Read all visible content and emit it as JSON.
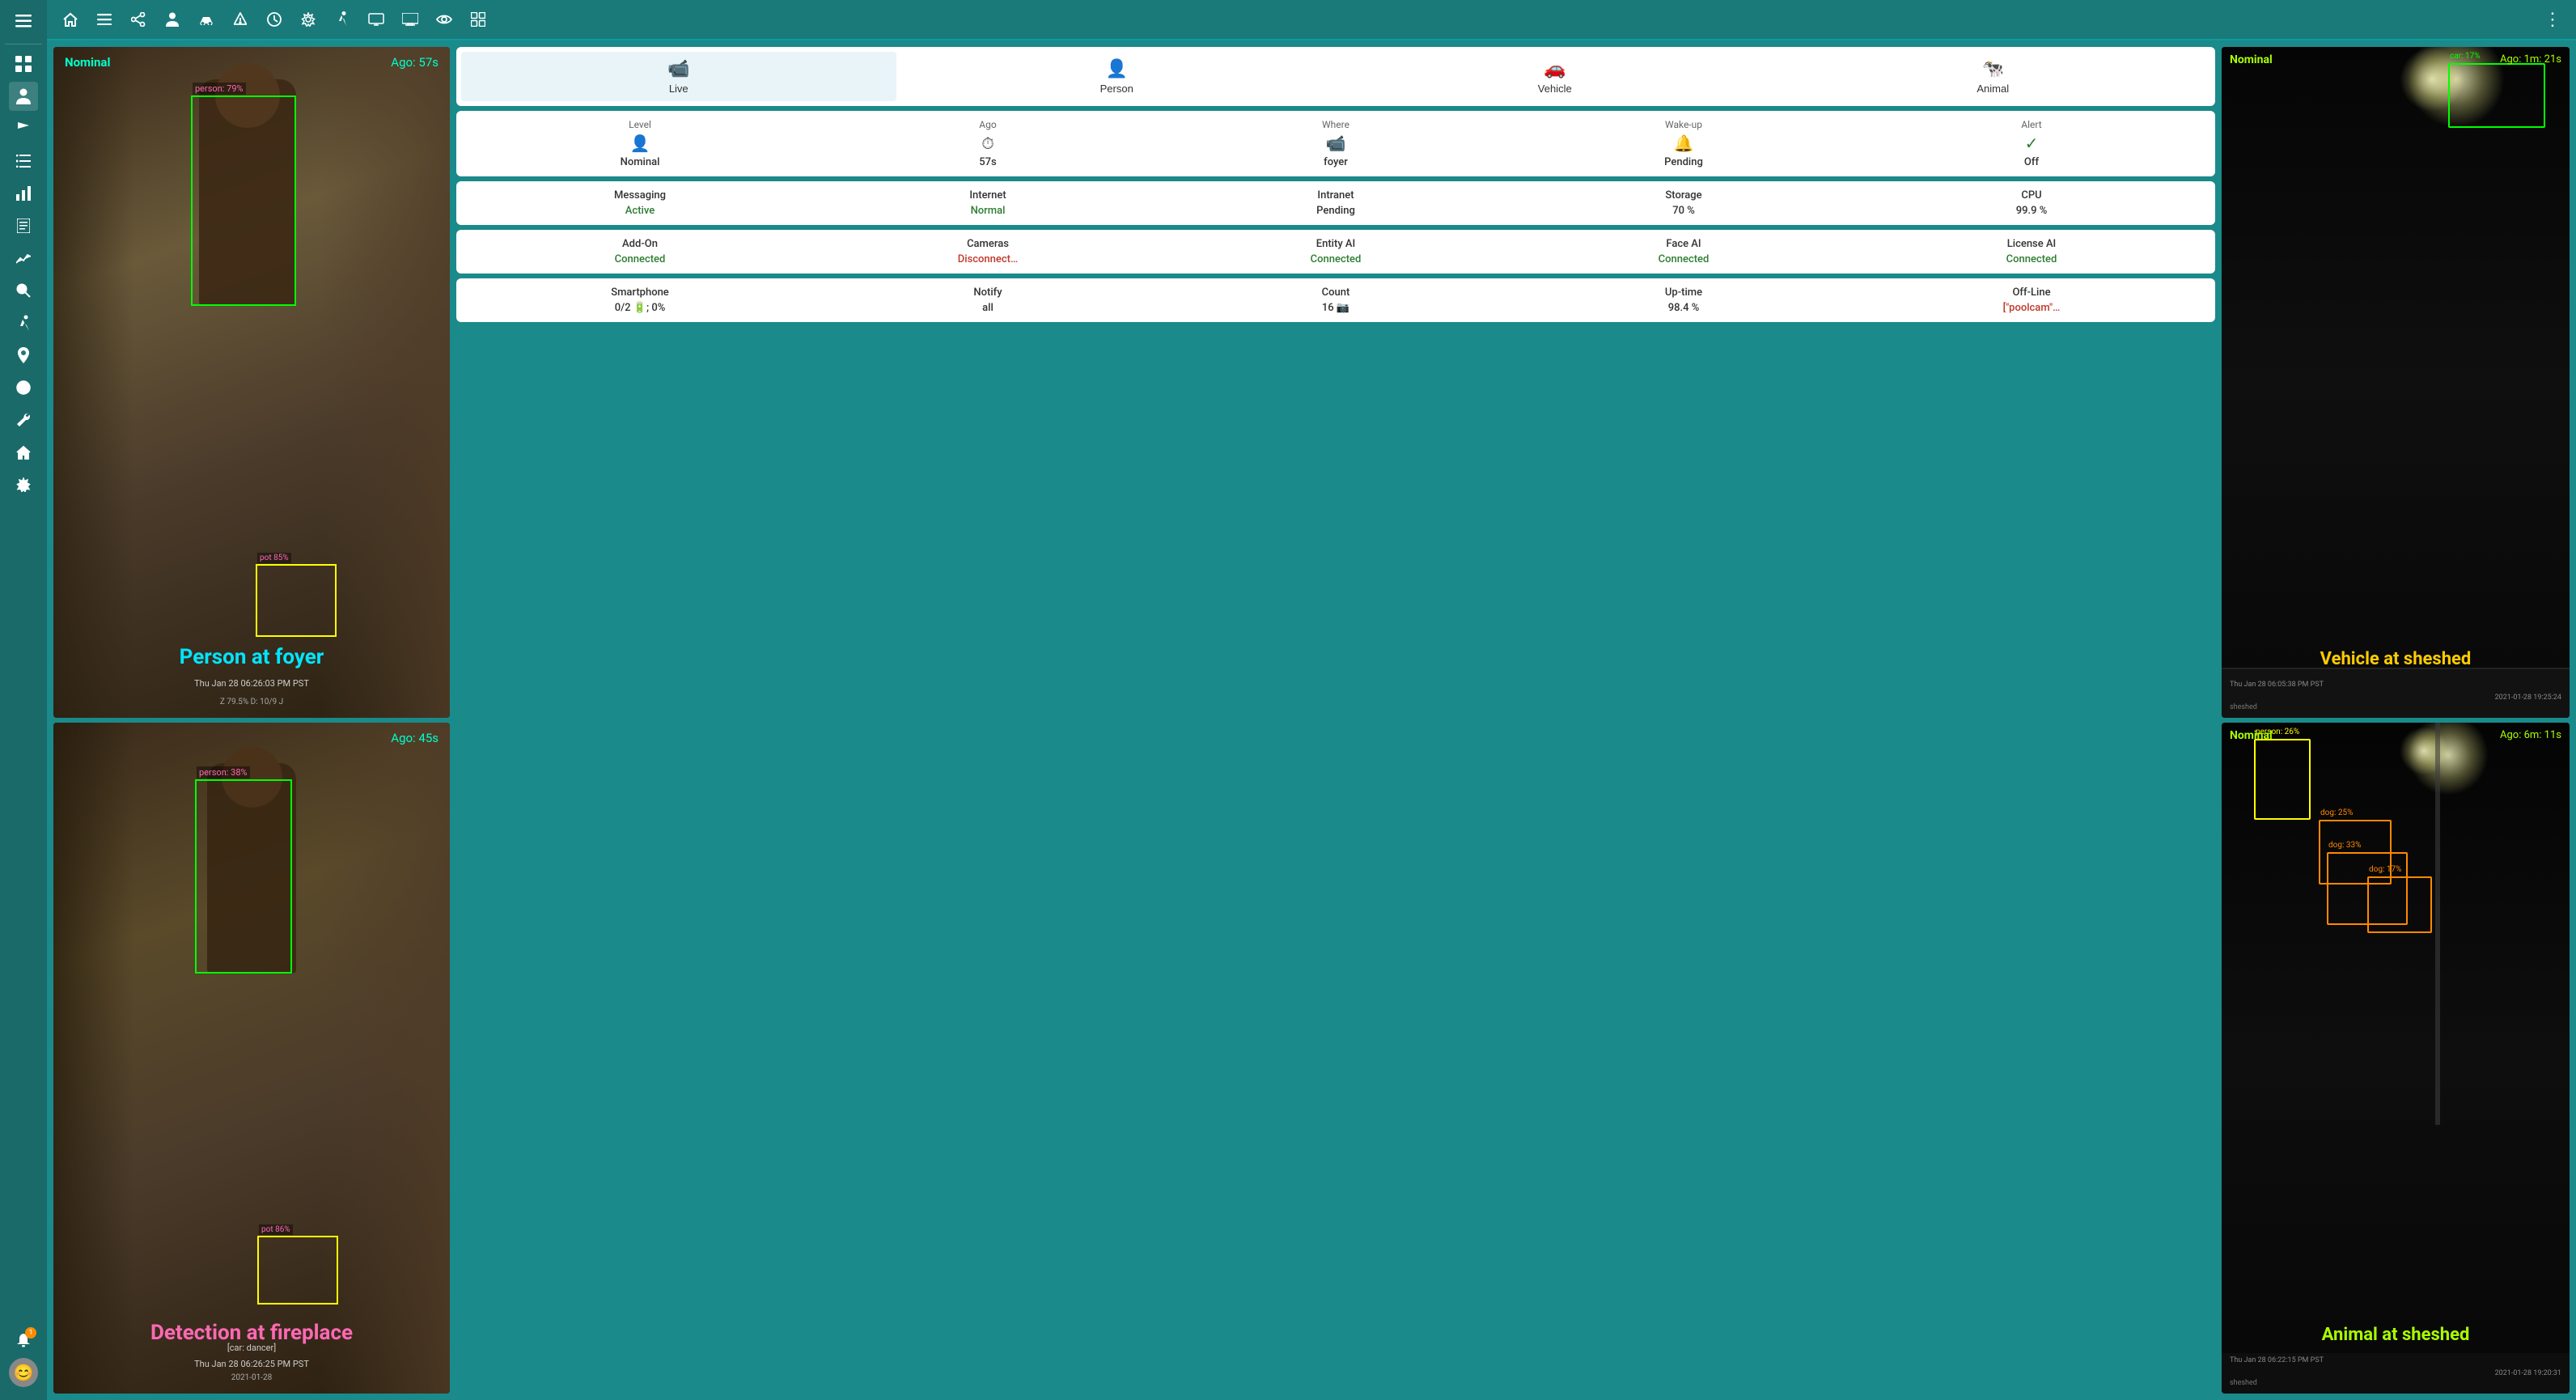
{
  "sidebar": {
    "items": [
      {
        "name": "menu",
        "icon": "☰"
      },
      {
        "name": "home",
        "icon": "⌂"
      },
      {
        "name": "collapse",
        "icon": "≡"
      },
      {
        "name": "share",
        "icon": "⎇"
      },
      {
        "name": "person",
        "icon": "👤"
      },
      {
        "name": "vehicle",
        "icon": "🚗"
      },
      {
        "name": "bug",
        "icon": "🐛"
      },
      {
        "name": "clock",
        "icon": "⏰"
      },
      {
        "name": "settings",
        "icon": "⚙"
      },
      {
        "name": "walk",
        "icon": "🚶"
      },
      {
        "name": "display",
        "icon": "📺"
      },
      {
        "name": "monitor",
        "icon": "🖥"
      },
      {
        "name": "eye",
        "icon": "👁"
      },
      {
        "name": "grid",
        "icon": "⊞"
      },
      {
        "name": "dashboard",
        "icon": "⊟"
      },
      {
        "name": "person-active",
        "icon": "👤"
      },
      {
        "name": "flag",
        "icon": "⚑"
      },
      {
        "name": "list",
        "icon": "≣"
      },
      {
        "name": "chart",
        "icon": "📊"
      },
      {
        "name": "log",
        "icon": "📋"
      },
      {
        "name": "analytics",
        "icon": "📈"
      },
      {
        "name": "search",
        "icon": "🔍"
      },
      {
        "name": "run",
        "icon": "🏃"
      },
      {
        "name": "location",
        "icon": "📍"
      },
      {
        "name": "play",
        "icon": "▶"
      },
      {
        "name": "wrench",
        "icon": "🔧"
      },
      {
        "name": "home2",
        "icon": "🏠"
      },
      {
        "name": "gear",
        "icon": "⚙"
      },
      {
        "name": "bell",
        "icon": "🔔"
      },
      {
        "name": "avatar",
        "icon": "😊"
      }
    ],
    "notification_count": "1"
  },
  "topnav": {
    "icons": [
      "⌂",
      "≡",
      "⎇",
      "👤",
      "🚗",
      "🐛",
      "⏰",
      "⚙",
      "🚶",
      "📺",
      "🖥",
      "👁",
      "⊞"
    ],
    "more_icon": "⋮"
  },
  "camera_left_top": {
    "status": "Nominal",
    "ago": "Ago: 57s",
    "event": "Person at foyer",
    "datetime": "Thu Jan 28 06:26:03 PM PST",
    "meta": "Z 79.5% D: 10/9 J",
    "overlay_label": "person: 79%"
  },
  "camera_left_bottom": {
    "status": "",
    "ago": "Ago: 45s",
    "event": "Detection at fireplace",
    "sublabel": "[car: dancer]",
    "datetime": "Thu Jan 28 06:26:25 PM PST",
    "meta": "2021-01-28",
    "overlay_label": "person: 38%"
  },
  "tabs": [
    {
      "id": "live",
      "icon": "📹",
      "label": "Live"
    },
    {
      "id": "person",
      "icon": "👤",
      "label": "Person"
    },
    {
      "id": "vehicle",
      "icon": "🚗",
      "label": "Vehicle"
    },
    {
      "id": "animal",
      "icon": "🐄",
      "label": "Animal"
    }
  ],
  "info_section1": {
    "headers": [
      "Level",
      "Ago",
      "Where",
      "Wake-up",
      "Alert"
    ],
    "icons": [
      "👤",
      "⏱",
      "📹",
      "🔔",
      "✓"
    ],
    "values": [
      "Nominal",
      "57s",
      "foyer",
      "Pending",
      "Off"
    ]
  },
  "info_section2": {
    "col1": {
      "label": "Messaging",
      "value": "Active"
    },
    "col2": {
      "label": "Internet",
      "value": "Normal"
    },
    "col3": {
      "label": "Intranet",
      "value": "Pending"
    },
    "col4": {
      "label": "Storage",
      "value": "70 %"
    },
    "col5": {
      "label": "CPU",
      "value": "99.9 %"
    }
  },
  "info_section3": {
    "col1": {
      "label": "Add-On",
      "value": "Connected"
    },
    "col2": {
      "label": "Cameras",
      "value": "Disconnect…"
    },
    "col3": {
      "label": "Entity AI",
      "value": "Connected"
    },
    "col4": {
      "label": "Face AI",
      "value": "Connected"
    },
    "col5": {
      "label": "License AI",
      "value": "Connected"
    }
  },
  "info_section4": {
    "col1": {
      "label": "Smartphone",
      "value": "0/2 🔋; 0%"
    },
    "col2": {
      "label": "Notify",
      "value": "all"
    },
    "col3": {
      "label": "Count",
      "value": "16 📷"
    },
    "col4": {
      "label": "Up-time",
      "value": "98.4 %"
    },
    "col5": {
      "label": "Off-Line",
      "value": "[\"poolcam\"…"
    }
  },
  "camera_right_top": {
    "status": "Nominal",
    "ago": "Ago: 1m: 21s",
    "event": "Vehicle at sheshed",
    "datetime": "Thu Jan 28 06:05:38 PM PST",
    "timestamp": "2021-01-28 19:25:24",
    "meta": "sheshed",
    "detect_label": "car: 17%"
  },
  "camera_right_bottom": {
    "status": "Nominal",
    "ago": "Ago: 6m: 11s",
    "event": "Animal at sheshed",
    "datetime": "Thu Jan 28 06:22:15 PM PST",
    "timestamp": "2021-01-28 19:20:31",
    "meta": "sheshed",
    "detect_labels": [
      "person: 26%",
      "dog: 25%",
      "dog: 33%",
      "dog: 17%"
    ]
  }
}
